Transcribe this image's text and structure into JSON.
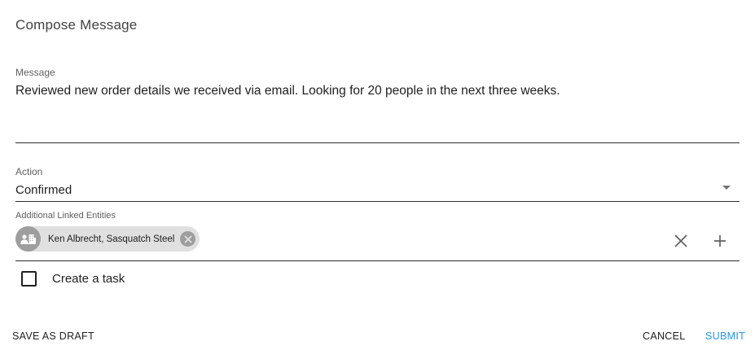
{
  "dialog": {
    "title": "Compose Message"
  },
  "message": {
    "label": "Message",
    "value": "Reviewed new order details we received via email. Looking for 20 people in the next three weeks."
  },
  "action": {
    "label": "Action",
    "value": "Confirmed"
  },
  "linked_entities": {
    "label": "Additional Linked Entities",
    "chips": [
      {
        "label": "Ken Albrecht, Sasquatch Steel",
        "icon": "contact-building-icon"
      }
    ],
    "clear_icon": "close-icon",
    "add_icon": "plus-icon"
  },
  "task": {
    "label": "Create a task",
    "checked": false
  },
  "buttons": {
    "save_draft": "SAVE AS DRAFT",
    "cancel": "CANCEL",
    "submit": "SUBMIT"
  },
  "colors": {
    "accent": "#2196f3",
    "chip_bg": "#e0e0e0",
    "chip_icon_bg": "#9e9e9e"
  }
}
